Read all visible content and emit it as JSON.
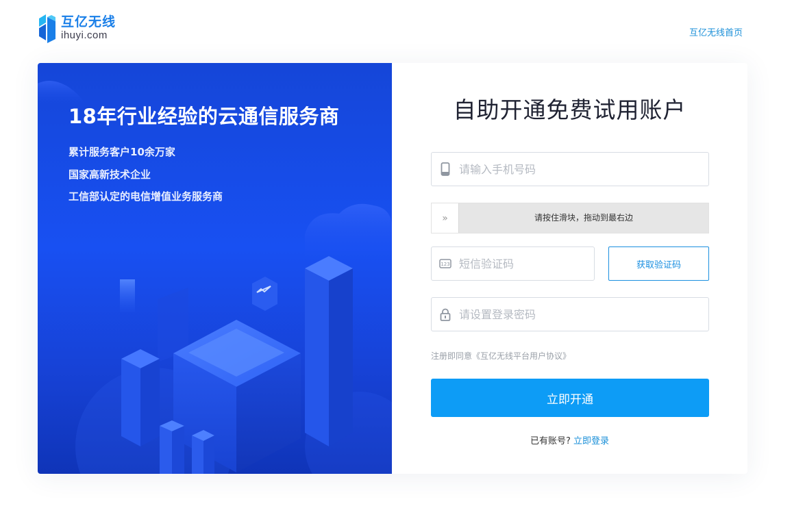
{
  "brand": {
    "name_cn": "互亿无线",
    "domain": "ihuyi.com",
    "color": "#1a7fe8"
  },
  "header": {
    "home_link": "互亿无线首页"
  },
  "promo": {
    "title": "18年行业经验的云通信服务商",
    "lines": [
      "累计服务客户10余万家",
      "国家高新技术企业",
      "工信部认定的电信增值业务服务商"
    ]
  },
  "form": {
    "title": "自助开通免费试用账户",
    "phone": {
      "placeholder": "请输入手机号码",
      "value": "",
      "icon": "phone-icon"
    },
    "slider": {
      "hint": "请按住滑块，拖动到最右边",
      "handle_glyph": "»"
    },
    "sms_code": {
      "placeholder": "短信验证码",
      "value": "",
      "icon": "code-123-icon"
    },
    "get_code_button": "获取验证码",
    "password": {
      "placeholder": "请设置登录密码",
      "value": "",
      "icon": "lock-icon"
    },
    "agreement_prefix": "注册即同意",
    "agreement_link": "《互亿无线平台用户协议》",
    "submit_button": "立即开通",
    "login_prompt": "已有账号?",
    "login_link": "立即登录"
  },
  "colors": {
    "accent": "#0d9cf6",
    "link": "#1a8fd8",
    "promo_blue": "#1850f2"
  }
}
